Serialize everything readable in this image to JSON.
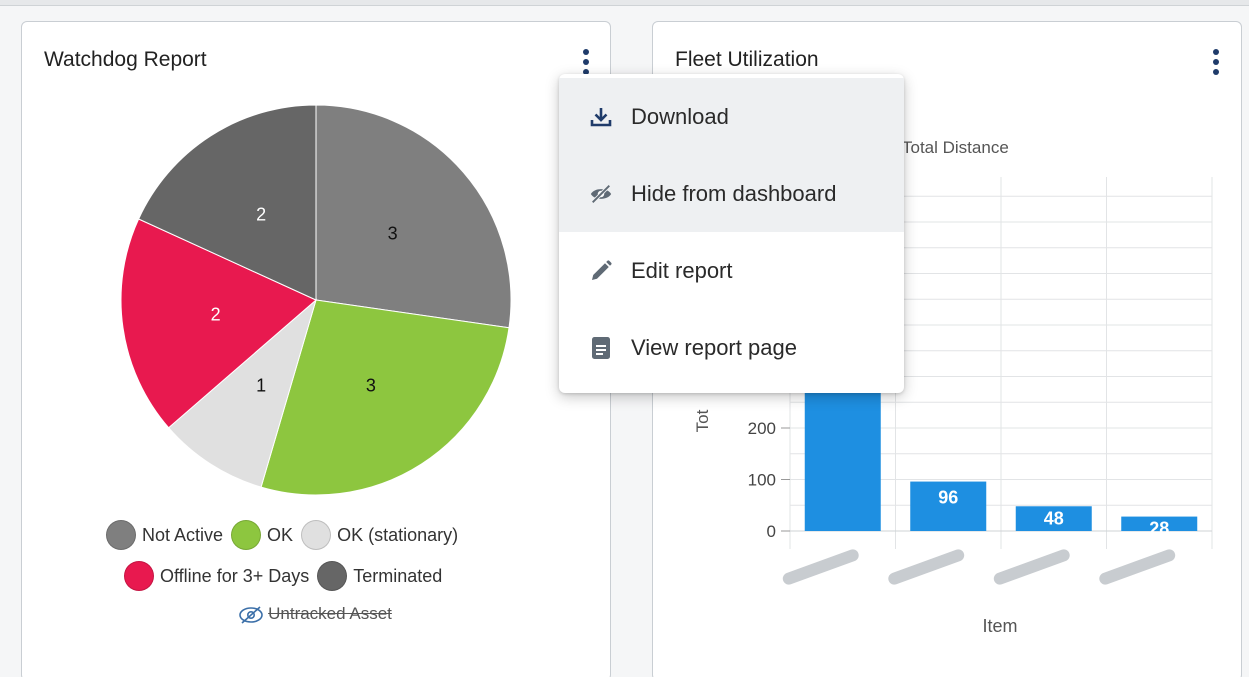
{
  "watchdog": {
    "title": "Watchdog Report",
    "legend": [
      {
        "label": "Not Active",
        "color": "#7f7f7f"
      },
      {
        "label": "OK",
        "color": "#8dc63f"
      },
      {
        "label": "OK (stationary)",
        "color": "#e0e0e0"
      },
      {
        "label": "Offline for 3+ Days",
        "color": "#e8194f"
      },
      {
        "label": "Terminated",
        "color": "#666666"
      }
    ],
    "hidden_legend": "Untracked Asset"
  },
  "fleet": {
    "title": "Fleet Utilization",
    "chart_subtitle": "Total Distance",
    "ylabel": "Tot",
    "xlabel": "Item"
  },
  "menu": {
    "items": [
      {
        "label": "Download",
        "icon": "download-icon"
      },
      {
        "label": "Hide from dashboard",
        "icon": "eye-off-icon"
      },
      {
        "label": "Edit report",
        "icon": "pencil-icon"
      },
      {
        "label": "View report page",
        "icon": "document-icon"
      }
    ]
  },
  "chart_data": [
    {
      "type": "pie",
      "title": "Watchdog Report",
      "categories": [
        "Not Active",
        "OK",
        "OK (stationary)",
        "Offline for 3+ Days",
        "Terminated"
      ],
      "values": [
        3,
        3,
        1,
        2,
        2
      ],
      "colors": [
        "#7f7f7f",
        "#8dc63f",
        "#e0e0e0",
        "#e8194f",
        "#666666"
      ],
      "legend": "bottom"
    },
    {
      "type": "bar",
      "title": "Total Distance",
      "xlabel": "Item",
      "ylabel": "Tot",
      "categories": [
        "",
        "",
        "",
        ""
      ],
      "values": [
        300,
        96,
        48,
        28
      ],
      "data_labels": [
        "",
        "96",
        "48",
        "28"
      ],
      "yticks": [
        0,
        100,
        200
      ],
      "color": "#1e8fe1",
      "grid": true
    }
  ]
}
